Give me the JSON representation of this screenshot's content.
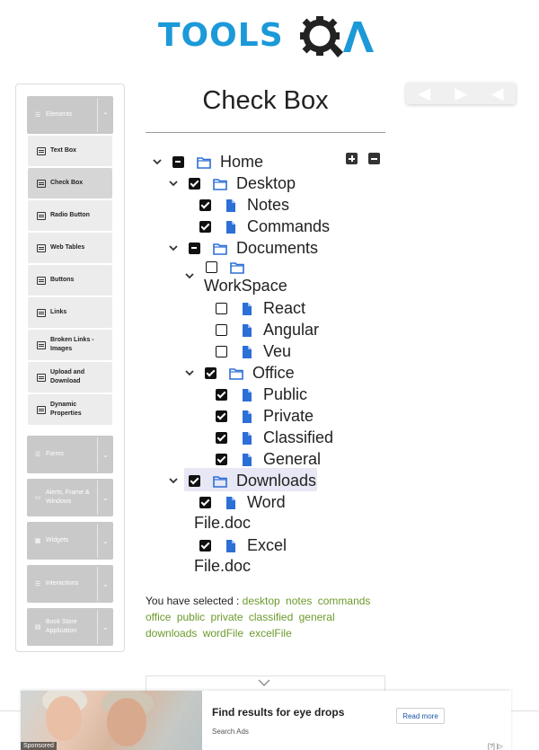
{
  "header": {
    "logo_text": "TOOLS",
    "logo_qa": "QA"
  },
  "sidebar": {
    "groups": [
      {
        "label": "Elements",
        "icon": "list-icon",
        "expanded": true
      },
      {
        "label": "Forms",
        "icon": "list-icon"
      },
      {
        "label": "Alerts, Frame & Windows",
        "icon": "window-icon"
      },
      {
        "label": "Widgets",
        "icon": "grid-icon"
      },
      {
        "label": "Interactions",
        "icon": "list-icon"
      },
      {
        "label": "Book Store Application",
        "icon": "book-icon"
      }
    ],
    "items": [
      {
        "label": "Text Box"
      },
      {
        "label": "Check Box",
        "active": true
      },
      {
        "label": "Radio Button"
      },
      {
        "label": "Web Tables"
      },
      {
        "label": "Buttons"
      },
      {
        "label": "Links"
      },
      {
        "label": "Broken Links - Images"
      },
      {
        "label": "Upload and Download"
      },
      {
        "label": "Dynamic Properties"
      }
    ]
  },
  "main": {
    "title": "Check Box",
    "tree": {
      "home": "Home",
      "desktop": "Desktop",
      "notes": "Notes",
      "commands": "Commands",
      "documents": "Documents",
      "workspace": "WorkSpace",
      "react": "React",
      "angular": "Angular",
      "veu": "Veu",
      "office": "Office",
      "public": "Public",
      "private": "Private",
      "classified": "Classified",
      "general": "General",
      "downloads": "Downloads",
      "word_file_1": "Word",
      "word_file_2": "File.doc",
      "excel_file_1": "Excel",
      "excel_file_2": "File.doc"
    },
    "result_prefix": "You have selected :",
    "selected": [
      "desktop",
      "notes",
      "commands",
      "office",
      "public",
      "private",
      "classified",
      "general",
      "downloads",
      "wordFile",
      "excelFile"
    ]
  },
  "ad": {
    "title": "Find results for eye drops",
    "source": "Search Ads",
    "button": "Read more",
    "sponsored": "Sponsored",
    "info": "[?] |▷"
  },
  "colors": {
    "brand": "#1b99d8",
    "selection": "#6c9a2c",
    "sidebar_header": "#c9c9c9"
  }
}
